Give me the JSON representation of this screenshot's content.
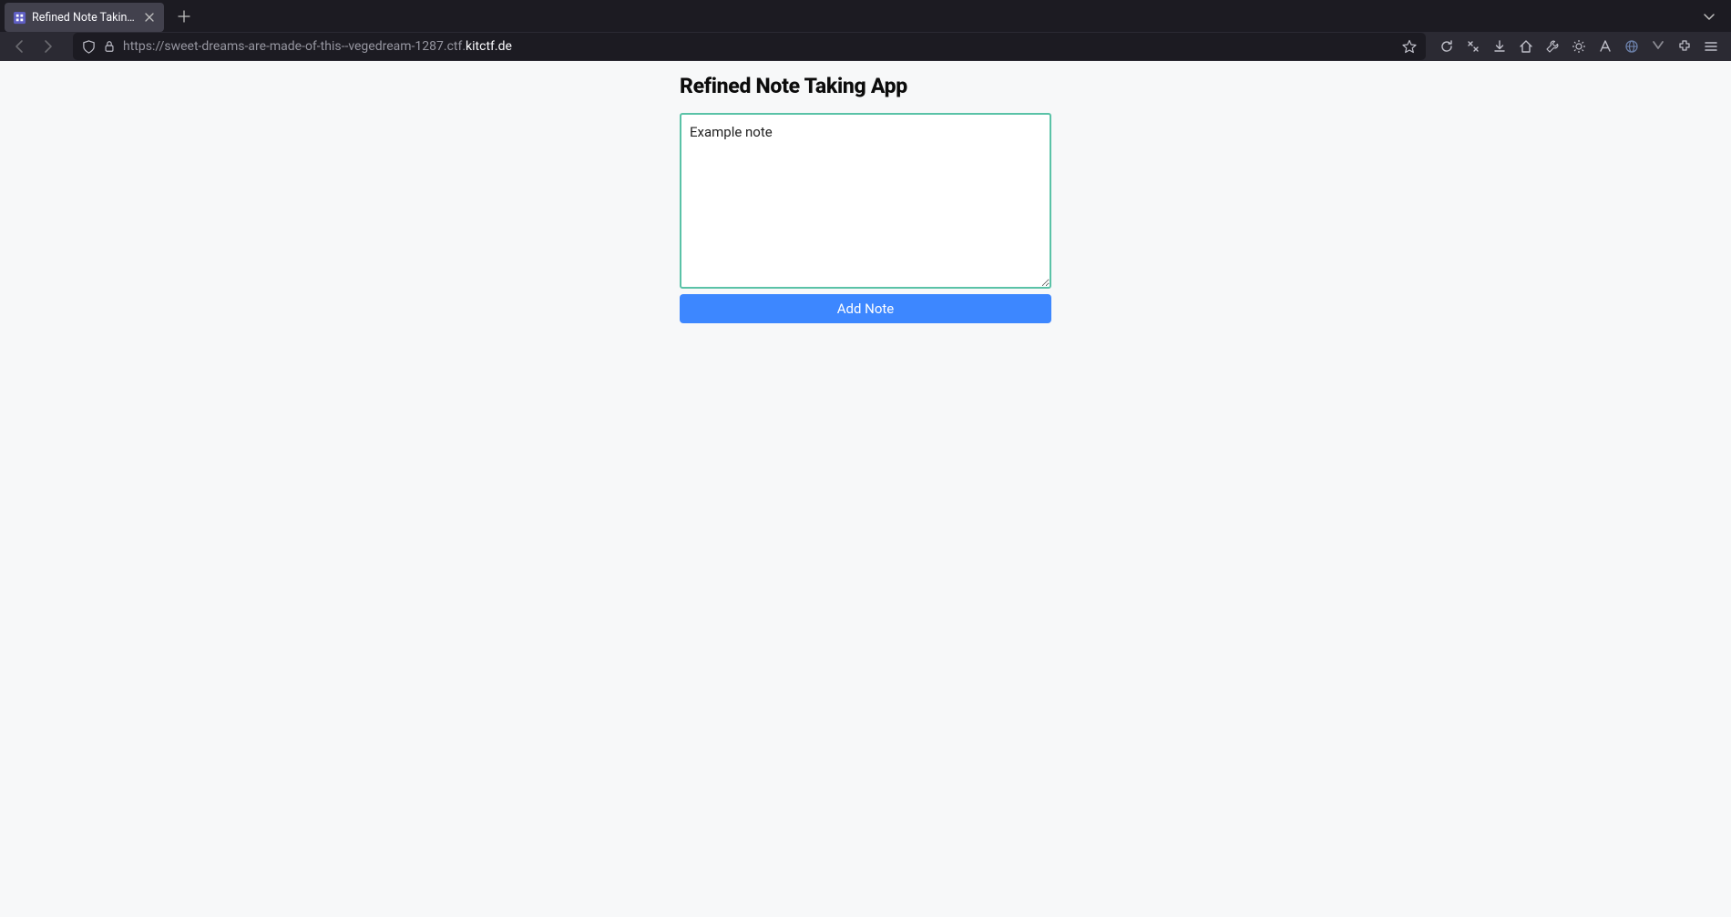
{
  "browser": {
    "tab": {
      "title": "Refined Note Taking App"
    },
    "url": {
      "prefix": "https://sweet-dreams-are-made-of-this--vegedream-1287.ctf.",
      "highlight": "kitctf.de"
    }
  },
  "page": {
    "title": "Refined Note Taking App",
    "textarea_value": "Example note",
    "add_button_label": "Add Note"
  }
}
